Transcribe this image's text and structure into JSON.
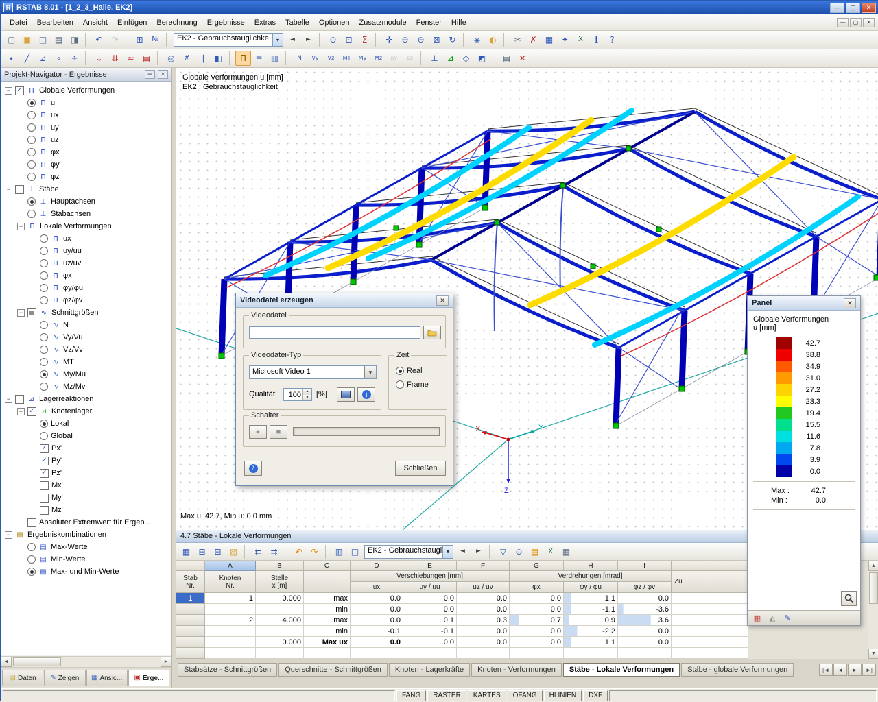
{
  "window": {
    "title": "RSTAB 8.01 - [1_2_3_Halle, EK2]"
  },
  "menu": [
    "Datei",
    "Bearbeiten",
    "Ansicht",
    "Einfügen",
    "Berechnung",
    "Ergebnisse",
    "Extras",
    "Tabelle",
    "Optionen",
    "Zusatzmodule",
    "Fenster",
    "Hilfe"
  ],
  "toolbar1": [
    {
      "n": "new-file",
      "g": "▢",
      "c": "#5A6B85"
    },
    {
      "n": "open-file",
      "g": "▣",
      "c": "#D9A23A"
    },
    {
      "n": "save",
      "g": "◫",
      "c": "#4A6DA8"
    },
    {
      "n": "print",
      "g": "▤",
      "c": "#5A6B85"
    },
    {
      "n": "print-preview",
      "g": "◨",
      "c": "#5A6B85"
    },
    {
      "t": "sep"
    },
    {
      "n": "undo",
      "g": "↶",
      "c": "#2F58B8"
    },
    {
      "n": "redo",
      "g": "↷",
      "c": "#9AA4B8",
      "dis": true
    },
    {
      "t": "sep"
    },
    {
      "n": "new-table",
      "g": "⊞",
      "c": "#2F58B8"
    },
    {
      "n": "renumber",
      "g": "№",
      "c": "#2F58B8",
      "fs": 10
    },
    {
      "t": "sep"
    },
    {
      "t": "combo",
      "n": "loadcase-combo",
      "v": "EK2 - Gebrauchstauglichke",
      "w": 160
    },
    {
      "n": "previous-loadcase",
      "g": "◄",
      "c": "#444",
      "fs": 9
    },
    {
      "n": "next-loadcase",
      "g": "►",
      "c": "#444",
      "fs": 9
    },
    {
      "t": "sep"
    },
    {
      "n": "find-object",
      "g": "⊙",
      "c": "#2F58B8"
    },
    {
      "n": "visual-selection",
      "g": "⊡",
      "c": "#2F58B8"
    },
    {
      "n": "calculation",
      "g": "Σ",
      "c": "#C03838"
    },
    {
      "t": "sep"
    },
    {
      "n": "move-view",
      "g": "✛",
      "c": "#2F58B8"
    },
    {
      "n": "zoom-in",
      "g": "⊕",
      "c": "#2F58B8"
    },
    {
      "n": "zoom-out",
      "g": "⊖",
      "c": "#2F58B8"
    },
    {
      "n": "zoom-window",
      "g": "⊠",
      "c": "#2F58B8"
    },
    {
      "n": "rotate-view",
      "g": "↻",
      "c": "#2F58B8"
    },
    {
      "t": "sep"
    },
    {
      "n": "isometric-view",
      "g": "◈",
      "c": "#2F58B8"
    },
    {
      "n": "render-model",
      "g": "◐",
      "c": "#D9A23A"
    },
    {
      "t": "sep"
    },
    {
      "n": "cut",
      "g": "✂",
      "c": "#5A6B85"
    },
    {
      "n": "delete",
      "g": "✗",
      "c": "#C03030"
    },
    {
      "n": "tables-toggle",
      "g": "▦",
      "c": "#2F58B8"
    },
    {
      "n": "modules",
      "g": "✦",
      "c": "#2F58B8"
    },
    {
      "n": "excel-export",
      "g": "X",
      "c": "#1E7145",
      "fs": 10
    },
    {
      "n": "info",
      "g": "ℹ",
      "c": "#2F58B8"
    },
    {
      "n": "help",
      "g": "?",
      "c": "#2F58B8"
    }
  ],
  "toolbar2": [
    {
      "n": "new-node",
      "g": "∙",
      "c": "#2F58B8"
    },
    {
      "n": "new-member",
      "g": "╱",
      "c": "#2F58B8"
    },
    {
      "n": "new-support",
      "g": "⊿",
      "c": "#2F58B8"
    },
    {
      "n": "new-hinge",
      "g": "∘",
      "c": "#2F58B8"
    },
    {
      "n": "divide-member",
      "g": "÷",
      "c": "#2F58B8"
    },
    {
      "t": "sep"
    },
    {
      "n": "node-load",
      "g": "↓",
      "c": "#C03030"
    },
    {
      "n": "member-load",
      "g": "⇊",
      "c": "#C03030"
    },
    {
      "n": "imperfection",
      "g": "≈",
      "c": "#C03030"
    },
    {
      "n": "load-cases",
      "g": "▤",
      "c": "#C03030"
    },
    {
      "t": "sep"
    },
    {
      "n": "visibility",
      "g": "◎",
      "c": "#2F58B8"
    },
    {
      "n": "numbering-toggle",
      "g": "#",
      "c": "#2F58B8",
      "fs": 10
    },
    {
      "n": "guidelines",
      "g": "∥",
      "c": "#2F58B8"
    },
    {
      "n": "work-plane",
      "g": "◧",
      "c": "#2F58B8"
    },
    {
      "t": "sep"
    },
    {
      "n": "results-toggle",
      "g": "Π",
      "c": "#8A5A00",
      "p": true
    },
    {
      "n": "result-values",
      "g": "≡",
      "c": "#2F58B8"
    },
    {
      "n": "panel-toggle",
      "g": "▥",
      "c": "#2F58B8"
    },
    {
      "t": "sep"
    },
    {
      "n": "result-n",
      "g": "N",
      "c": "#2F58B8",
      "fs": 9
    },
    {
      "n": "result-vy",
      "g": "Vy",
      "c": "#2F58B8",
      "fs": 8
    },
    {
      "n": "result-vz",
      "g": "Vz",
      "c": "#2F58B8",
      "fs": 8
    },
    {
      "n": "result-mt",
      "g": "MT",
      "c": "#2F58B8",
      "fs": 8
    },
    {
      "n": "result-my",
      "g": "My",
      "c": "#2F58B8",
      "fs": 8
    },
    {
      "n": "result-mz",
      "g": "Mz",
      "c": "#2F58B8",
      "fs": 8
    },
    {
      "n": "result-py",
      "g": "py",
      "c": "#9AA4B8",
      "fs": 8,
      "dis": true
    },
    {
      "n": "result-pz",
      "g": "pz",
      "c": "#9AA4B8",
      "fs": 8,
      "dis": true
    },
    {
      "t": "sep"
    },
    {
      "n": "member-axes",
      "g": "⊥",
      "c": "#2F58B8"
    },
    {
      "n": "supports-view",
      "g": "⊿",
      "c": "#00A000"
    },
    {
      "n": "wireframe-view",
      "g": "◇",
      "c": "#2F58B8"
    },
    {
      "n": "background-settings",
      "g": "◩",
      "c": "#2F58B8"
    },
    {
      "t": "sep"
    },
    {
      "n": "print-graphic",
      "g": "▤",
      "c": "#5A6B85"
    },
    {
      "n": "close-results",
      "g": "✕",
      "c": "#C03030"
    }
  ],
  "navigator": {
    "title": "Projekt-Navigator - Ergebnisse",
    "tree": [
      {
        "l": "Globale Verformungen",
        "lv": 0,
        "c": "c1",
        "i": "Π",
        "e": 1
      },
      {
        "l": "u",
        "lv": 1,
        "c": "r1",
        "i": "Π"
      },
      {
        "l": "ux",
        "lv": 1,
        "c": "r0",
        "i": "Π"
      },
      {
        "l": "uy",
        "lv": 1,
        "c": "r0",
        "i": "Π"
      },
      {
        "l": "uz",
        "lv": 1,
        "c": "r0",
        "i": "Π"
      },
      {
        "l": "φx",
        "lv": 1,
        "c": "r0",
        "i": "Π"
      },
      {
        "l": "φy",
        "lv": 1,
        "c": "r0",
        "i": "Π"
      },
      {
        "l": "φz",
        "lv": 1,
        "c": "r0",
        "i": "Π"
      },
      {
        "l": "Stäbe",
        "lv": 0,
        "c": "c0",
        "i": "⊥",
        "e": 1
      },
      {
        "l": "Hauptachsen",
        "lv": 1,
        "c": "r1",
        "i": "⊥"
      },
      {
        "l": "Stabachsen",
        "lv": 1,
        "c": "r0",
        "i": "⊥"
      },
      {
        "l": "Lokale Verformungen",
        "lv": 1,
        "c": "",
        "i": "Π",
        "e": 1
      },
      {
        "l": "ux",
        "lv": 2,
        "c": "r0",
        "i": "Π"
      },
      {
        "l": "uy/uu",
        "lv": 2,
        "c": "r0",
        "i": "Π"
      },
      {
        "l": "uz/uv",
        "lv": 2,
        "c": "r0",
        "i": "Π"
      },
      {
        "l": "φx",
        "lv": 2,
        "c": "r0",
        "i": "Π"
      },
      {
        "l": "φy/φu",
        "lv": 2,
        "c": "r0",
        "i": "Π"
      },
      {
        "l": "φz/φv",
        "lv": 2,
        "c": "r0",
        "i": "Π"
      },
      {
        "l": "Schnittgrößen",
        "lv": 1,
        "c": "cm",
        "i": "∿",
        "e": 1
      },
      {
        "l": "N",
        "lv": 2,
        "c": "r0",
        "i": "∿"
      },
      {
        "l": "Vy/Vu",
        "lv": 2,
        "c": "r0",
        "i": "∿"
      },
      {
        "l": "Vz/Vv",
        "lv": 2,
        "c": "r0",
        "i": "∿"
      },
      {
        "l": "MT",
        "lv": 2,
        "c": "r0",
        "i": "∿"
      },
      {
        "l": "My/Mu",
        "lv": 2,
        "c": "r1",
        "i": "∿"
      },
      {
        "l": "Mz/Mv",
        "lv": 2,
        "c": "r0",
        "i": "∿"
      },
      {
        "l": "Lagerreaktionen",
        "lv": 0,
        "c": "c0",
        "i": "⊿",
        "e": 1
      },
      {
        "l": "Knotenlager",
        "lv": 1,
        "c": "c1",
        "i": "⊿",
        "ic": "#00A000",
        "e": 1
      },
      {
        "l": "Lokal",
        "lv": 2,
        "c": "r1"
      },
      {
        "l": "Global",
        "lv": 2,
        "c": "r0"
      },
      {
        "l": "Px'",
        "lv": 2,
        "c": "c1"
      },
      {
        "l": "Py'",
        "lv": 2,
        "c": "c1"
      },
      {
        "l": "Pz'",
        "lv": 2,
        "c": "c1"
      },
      {
        "l": "Mx'",
        "lv": 2,
        "c": "c0"
      },
      {
        "l": "My'",
        "lv": 2,
        "c": "c0"
      },
      {
        "l": "Mz'",
        "lv": 2,
        "c": "c0"
      },
      {
        "l": "Absoluter Extremwert für Ergeb...",
        "lv": 1,
        "c": "c0"
      },
      {
        "l": "Ergebniskombinationen",
        "lv": 0,
        "c": "",
        "i": "▤",
        "ic": "#B08820",
        "e": 1
      },
      {
        "l": "Max-Werte",
        "lv": 1,
        "c": "r0",
        "i": "▤"
      },
      {
        "l": "Min-Werte",
        "lv": 1,
        "c": "r0",
        "i": "▤"
      },
      {
        "l": "Max- und Min-Werte",
        "lv": 1,
        "c": "r1",
        "i": "▤"
      }
    ],
    "tabs": [
      {
        "label": "Daten",
        "g": "▤",
        "c": "#C8A020"
      },
      {
        "label": "Zeigen",
        "g": "✎",
        "c": "#2F58B8"
      },
      {
        "label": "Ansic...",
        "g": "▦",
        "c": "#2F58B8"
      },
      {
        "label": "Erge...",
        "g": "▣",
        "c": "#C03030",
        "active": true
      }
    ]
  },
  "view": {
    "line1": "Globale Verformungen u [mm]",
    "line2": "EK2 : Gebrauchstauglichkeit",
    "status": "Max u: 42.7, Min u: 0.0 mm"
  },
  "dialog": {
    "title": "Videodatei erzeugen",
    "group_file": "Videodatei",
    "file_value": "",
    "group_type": "Videodatei-Typ",
    "type_value": "Microsoft Video 1",
    "quality_label": "Qualität:",
    "quality_value": "100",
    "quality_unit": "[%]",
    "group_time": "Zeit",
    "time_options": [
      {
        "label": "Real",
        "selected": true
      },
      {
        "label": "Frame",
        "selected": false
      }
    ],
    "group_control": "Schalter",
    "close_button": "Schließen"
  },
  "panel": {
    "title": "Panel",
    "line1": "Globale Verformungen",
    "line2": "u [mm]",
    "scale": [
      {
        "v": "42.7",
        "c": "#A00000"
      },
      {
        "v": "38.8",
        "c": "#EE0000"
      },
      {
        "v": "34.9",
        "c": "#FF5A00"
      },
      {
        "v": "31.0",
        "c": "#FF9B00"
      },
      {
        "v": "27.2",
        "c": "#FFD300"
      },
      {
        "v": "23.3",
        "c": "#FFFF00"
      },
      {
        "v": "19.4",
        "c": "#20C820"
      },
      {
        "v": "15.5",
        "c": "#00E08C"
      },
      {
        "v": "11.6",
        "c": "#00E0E0"
      },
      {
        "v": "7.8",
        "c": "#00A8F0"
      },
      {
        "v": "3.9",
        "c": "#0048F0"
      },
      {
        "v": "0.0",
        "c": "#0000A8"
      }
    ],
    "max_label": "Max :",
    "max_value": "42.7",
    "min_label": "Min :",
    "min_value": "0.0",
    "foot_icons": [
      {
        "n": "panel-color-scale",
        "g": "▦",
        "c": "#C03030"
      },
      {
        "n": "panel-ramp",
        "g": "◭",
        "c": "#888888"
      },
      {
        "n": "panel-edit",
        "g": "✎",
        "c": "#2F58B8"
      }
    ]
  },
  "table": {
    "title": "4.7 Stäbe - Lokale Verformungen",
    "toolbar": [
      {
        "n": "table-settings",
        "g": "▦",
        "c": "#2F58B8"
      },
      {
        "n": "insert-row",
        "g": "⊞",
        "c": "#2F58B8"
      },
      {
        "n": "delete-row",
        "g": "⊟",
        "c": "#2F58B8"
      },
      {
        "n": "select-block",
        "g": "▨",
        "c": "#D9A23A"
      },
      {
        "t": "sep"
      },
      {
        "n": "jump-start",
        "g": "⇇",
        "c": "#2F58B8"
      },
      {
        "n": "jump-end",
        "g": "⇉",
        "c": "#2F58B8"
      },
      {
        "t": "sep"
      },
      {
        "n": "undo-table",
        "g": "↶",
        "c": "#E08A00"
      },
      {
        "n": "redo-table",
        "g": "↷",
        "c": "#E08A00"
      },
      {
        "t": "sep"
      },
      {
        "n": "view-mode",
        "g": "▥",
        "c": "#2F58B8"
      },
      {
        "n": "split-view",
        "g": "◫",
        "c": "#2F58B8"
      },
      {
        "t": "combo",
        "n": "table-loadcase-combo",
        "v": "EK2 - Gebrauchstaugli",
        "w": 130
      },
      {
        "n": "table-prev-loadcase",
        "g": "◄",
        "c": "#444",
        "fs": 9
      },
      {
        "n": "table-next-loadcase",
        "g": "►",
        "c": "#444",
        "fs": 9
      },
      {
        "t": "sep"
      },
      {
        "n": "table-filter",
        "g": "▽",
        "c": "#2F58B8"
      },
      {
        "n": "table-find",
        "g": "⊙",
        "c": "#2F58B8"
      },
      {
        "n": "table-print",
        "g": "▤",
        "c": "#E08A00"
      },
      {
        "n": "export-excel",
        "g": "X",
        "c": "#1E7145",
        "fs": 10
      },
      {
        "n": "table-ole",
        "g": "▦",
        "c": "#5A6B85"
      }
    ],
    "letters": [
      "A",
      "B",
      "C",
      "D",
      "E",
      "F",
      "G",
      "H",
      "I"
    ],
    "selected_letter": "A",
    "corner": {
      "l1": "Stab",
      "l2": "Nr."
    },
    "col1": {
      "l1": "Knoten",
      "l2": "Nr."
    },
    "col2": {
      "l1": "Stelle",
      "l2": "x [m]"
    },
    "group1": "Verschiebungen [mm]",
    "group2": "Verdrehungen [mrad]",
    "group3": "Zu",
    "sub": [
      "ux",
      "uy / uu",
      "uz / uv",
      "φx",
      "φy / φu",
      "φz / φv"
    ],
    "rows": [
      {
        "stab": "1",
        "knoten": "1",
        "x": "0.000",
        "kind": "max",
        "vals": [
          "0.0",
          "0.0",
          "0.0",
          "0.0",
          "1.1",
          "0.0"
        ],
        "sel": true,
        "bars": {
          "4": 13
        }
      },
      {
        "stab": "",
        "knoten": "",
        "x": "",
        "kind": "min",
        "vals": [
          "0.0",
          "0.0",
          "0.0",
          "0.0",
          "-1.1",
          "-3.6"
        ],
        "bars": {
          "4": 13,
          "5": 10
        }
      },
      {
        "stab": "",
        "knoten": "2",
        "x": "4.000",
        "kind": "max",
        "vals": [
          "0.0",
          "0.1",
          "0.3",
          "0.7",
          "0.9",
          "3.6"
        ],
        "bars": {
          "3": 18,
          "4": 10,
          "5": 62
        }
      },
      {
        "stab": "",
        "knoten": "",
        "x": "",
        "kind": "min",
        "vals": [
          "-0.1",
          "-0.1",
          "0.0",
          "0.0",
          "-2.2",
          "0.0"
        ],
        "bars": {
          "4": 25
        }
      },
      {
        "stab": "",
        "knoten": "",
        "x": "0.000",
        "kind": "Max ux",
        "vals": [
          "0.0",
          "0.0",
          "0.0",
          "0.0",
          "1.1",
          "0.0"
        ],
        "bold": true,
        "bars": {
          "4": 13
        }
      }
    ],
    "tabs": [
      "Stabsätze - Schnittgrößen",
      "Querschnitte - Schnittgrößen",
      "Knoten - Lagerkräfte",
      "Knoten - Verformungen",
      "Stäbe - Lokale Verformungen",
      "Stäbe - globale Verformungen"
    ],
    "active_tab": 4,
    "tab_nav": [
      "|◄",
      "◄",
      "►",
      "►|"
    ]
  },
  "statusbar": {
    "toggles": [
      "FANG",
      "RASTER",
      "KARTES",
      "OFANG",
      "HLINIEN",
      "DXF"
    ]
  }
}
